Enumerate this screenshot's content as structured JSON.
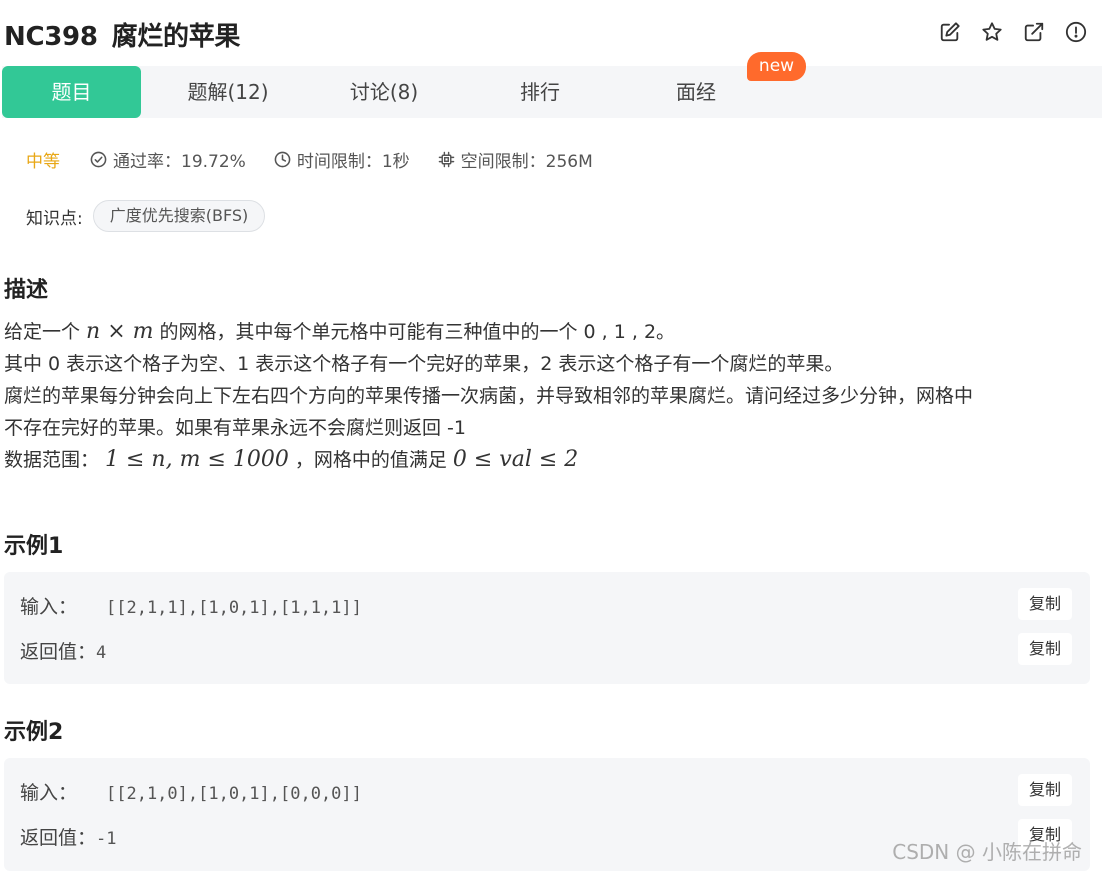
{
  "problem": {
    "code": "NC398",
    "title": "腐烂的苹果"
  },
  "header_icons": [
    "edit-icon",
    "star-icon",
    "external-link-icon",
    "alert-icon"
  ],
  "tabs": [
    {
      "label": "题目",
      "active": true
    },
    {
      "label": "题解(12)",
      "active": false
    },
    {
      "label": "讨论(8)",
      "active": false
    },
    {
      "label": "排行",
      "active": false
    },
    {
      "label": "面经",
      "active": false
    }
  ],
  "new_badge": "new",
  "meta": {
    "difficulty": "中等",
    "pass_rate": "通过率：19.72%",
    "time_limit": "时间限制：1秒",
    "space_limit": "空间限制：256M"
  },
  "knowledge": {
    "label": "知识点:",
    "tag": "广度优先搜索(BFS)"
  },
  "description": {
    "heading": "描述",
    "line1_a": "给定一个",
    "line1_math_n": "n",
    "line1_math_x": "×",
    "line1_math_m": "m",
    "line1_b": "的网格，其中每个单元格中可能有三种值中的一个 0 , 1 , 2。",
    "line2": "其中 0 表示这个格子为空、1 表示这个格子有一个完好的苹果，2 表示这个格子有一个腐烂的苹果。",
    "line3": "腐烂的苹果每分钟会向上下左右四个方向的苹果传播一次病菌，并导致相邻的苹果腐烂。请问经过多少分钟，网格中",
    "line4": "不存在完好的苹果。如果有苹果永远不会腐烂则返回 -1",
    "line5_a": "数据范围：",
    "line5_math1": "1 ≤ n, m ≤ 1000",
    "line5_b": "，网格中的值满足",
    "line5_math2": "0 ≤ val ≤ 2"
  },
  "examples": [
    {
      "heading": "示例1",
      "input_label": "输入：",
      "input_value": "[[2,1,1],[1,0,1],[1,1,1]]",
      "output_label": "返回值：",
      "output_value": "4",
      "copy_label": "复制"
    },
    {
      "heading": "示例2",
      "input_label": "输入：",
      "input_value": "[[2,1,0],[1,0,1],[0,0,0]]",
      "output_label": "返回值：",
      "output_value": "-1",
      "copy_label": "复制"
    }
  ],
  "watermark": "CSDN @  小陈在拼命",
  "colors": {
    "accent": "#32c896",
    "difficulty": "#e8a715",
    "badge": "#ff6a2c"
  }
}
